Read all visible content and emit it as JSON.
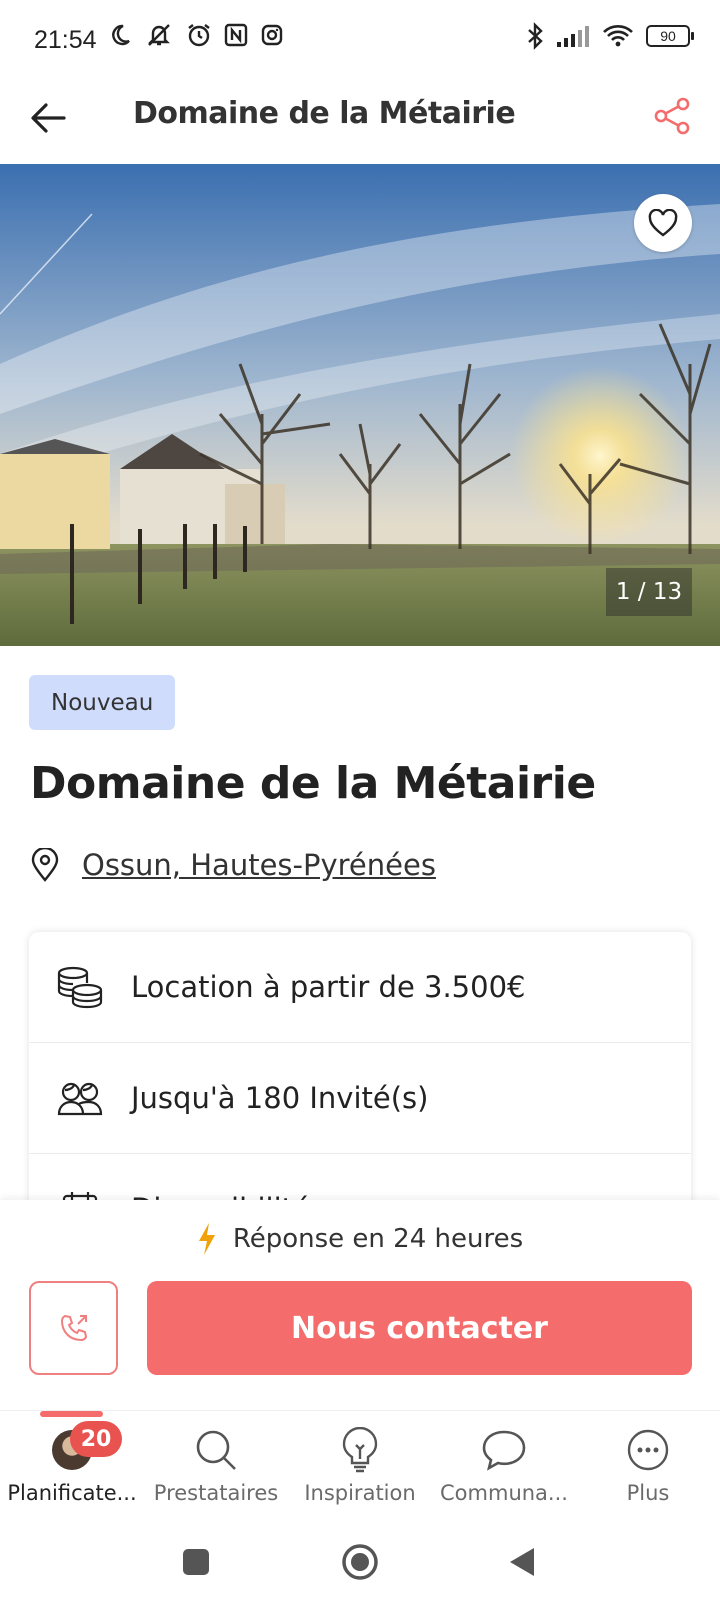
{
  "status_bar": {
    "time": "21:54",
    "battery": "90"
  },
  "header": {
    "title": "Domaine de la Métairie"
  },
  "hero": {
    "photo_counter": "1 / 13"
  },
  "listing": {
    "badge": "Nouveau",
    "title": "Domaine de la Métairie",
    "location": "Ossun, Hautes-Pyrénées",
    "info_rows": [
      {
        "icon": "coins-icon",
        "text": "Location à partir de 3.500€"
      },
      {
        "icon": "guests-icon",
        "text": "Jusqu'à 180 Invité(s)"
      },
      {
        "icon": "calendar-icon",
        "text": "Disponibilité"
      }
    ]
  },
  "actions": {
    "response_text": "Réponse en 24 heures",
    "contact_label": "Nous contacter"
  },
  "bottom_nav": {
    "badge_count": "20",
    "items": [
      {
        "label": "Planificate..."
      },
      {
        "label": "Prestataires"
      },
      {
        "label": "Inspiration"
      },
      {
        "label": "Communa..."
      },
      {
        "label": "Plus"
      }
    ]
  },
  "colors": {
    "accent": "#f46c6c",
    "badge_bg": "#cfdcfb",
    "notification": "#e8534f",
    "lightning": "#f0a20a"
  }
}
